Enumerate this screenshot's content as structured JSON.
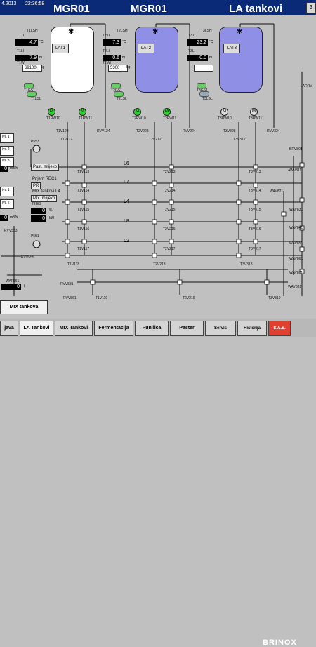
{
  "header": {
    "date": "4.2013",
    "time": "22:36:58",
    "title_left": "MGR01",
    "title_mid": "MGR01",
    "title_right": "LA tankovi",
    "corner": "3"
  },
  "tanks": [
    {
      "label": "LAT1",
      "t": "4.7",
      "l": "7.9",
      "w": "69100",
      "unit_t": "°C",
      "unit_l": "m",
      "unit_w": "kg",
      "tag_lsh": "T1LSH",
      "tag_ti": "T1TI",
      "tag_li": "T1LI",
      "tag_wi": "T1WI",
      "tag_gs": "T1GS1",
      "tag_lsl": "T1LSL",
      "rw1": "T1RW10",
      "rw2": "T1RW11",
      "fill_color": "#ffffff",
      "motor1": "M",
      "motor2": "M"
    },
    {
      "label": "LAT2",
      "t": "7.3",
      "l": "0.6",
      "w": "5300",
      "unit_t": "°C",
      "unit_l": "m",
      "unit_w": "kg",
      "tag_lsh": "T2LSH",
      "tag_ti": "T2TI",
      "tag_li": "T2LI",
      "tag_wi": "T2WI",
      "tag_gs": "T2GS1",
      "tag_lsl": "T2LSL",
      "rw1": "T2RW10",
      "rw2": "T2RW11",
      "fill_color": "#8f8fe6",
      "motor1": "M",
      "motor2": "M"
    },
    {
      "label": "LAT3",
      "t": "23.2",
      "l": "0.0",
      "w": "",
      "unit_t": "°C",
      "unit_l": "m",
      "unit_w": "",
      "tag_lsh": "T3LSH",
      "tag_ti": "T3TI",
      "tag_li": "T3LI",
      "tag_wi": "",
      "tag_gs": "T3GS1",
      "tag_lsl": "T3LSL",
      "rw1": "T3RW10",
      "rw2": "T3RW11",
      "fill_color": "#8f8fe6",
      "motor1": "M",
      "motor2": "M"
    }
  ],
  "valves": {
    "t1v129": "T1V129",
    "rvv124": "RVV124",
    "t1v112": "T1V112",
    "t2v228": "T2V228",
    "rvv224": "RVV224",
    "t2v212": "T2V212",
    "t3v328": "T3V328",
    "rvv324": "RVV324",
    "t3v312": "T3V312",
    "t1v113": "T1V113",
    "t2v213": "T2V213",
    "t3v313": "T3V313",
    "t1v114": "T1V114",
    "t2v214": "T2V214",
    "t3v314": "T3V314",
    "t1v115": "T1V115",
    "t2v215": "T2V215",
    "t3v315": "T3V315",
    "t1v116": "T1V116",
    "t2v216": "T2V216",
    "t3v316": "T3V316",
    "t1v117": "T1V117",
    "t2v217": "T2V217",
    "t3v317": "T3V317",
    "t1v118": "T1V118",
    "t2v218": "T2V218",
    "t3v318": "T3V318",
    "t1v119": "T1V119",
    "t2v219": "T2V219",
    "t3v319": "T3V319",
    "rvv553": "RVV553",
    "rvv555": "RVV555",
    "rvv561": "RVV561",
    "rvv581": "RVV581",
    "p553": "P553",
    "p551": "P551",
    "brv801": "BRV801",
    "awv811": "AWV811",
    "wav821": "WAV821",
    "wav831": "WAV831",
    "wav841": "WAV841",
    "wav851": "WAV851",
    "wav861": "WAV861",
    "wav871": "WAV871",
    "wav881": "WAV881",
    "larrv": "LARRV"
  },
  "lines": {
    "l6": "L6",
    "l7": "L7",
    "l4": "L4",
    "l8": "L8",
    "l2": "L2"
  },
  "labels": {
    "past_mlijeko": "Past. mlijeko",
    "prijem_rec": "Prijem REC1",
    "pr": "PR",
    "mix_tankovi_l4": "MIX tankovi L4",
    "mix_mlijeko": "Mix. mlijeko",
    "fi553": "FI553",
    "fi553_val1": "0",
    "fi553_unit1": "%",
    "fi553_val2": "0",
    "fi553_unit2": "kW",
    "waf561": "WAF561",
    "waf561_val": "0",
    "waf561_unit": "l",
    "side_val1": "0",
    "side_unit1": "m3/h",
    "side_val2": "0",
    "side_unit2": "m3/h",
    "side_labels": [
      "iva 1",
      "iva 2",
      "iva 3",
      "iva 1",
      "iva 2"
    ],
    "side_vals": [
      "I",
      "I",
      "I",
      "I",
      "I"
    ]
  },
  "nav": {
    "mix_tankova": "MIX tankova",
    "buttons": [
      "java",
      "LA Tankovi",
      "MIX Tankovi",
      "Fermentacija",
      "Punilica",
      "Paster",
      "Servis",
      "Historija",
      "S.A.S."
    ],
    "brand": "BRINOX"
  }
}
